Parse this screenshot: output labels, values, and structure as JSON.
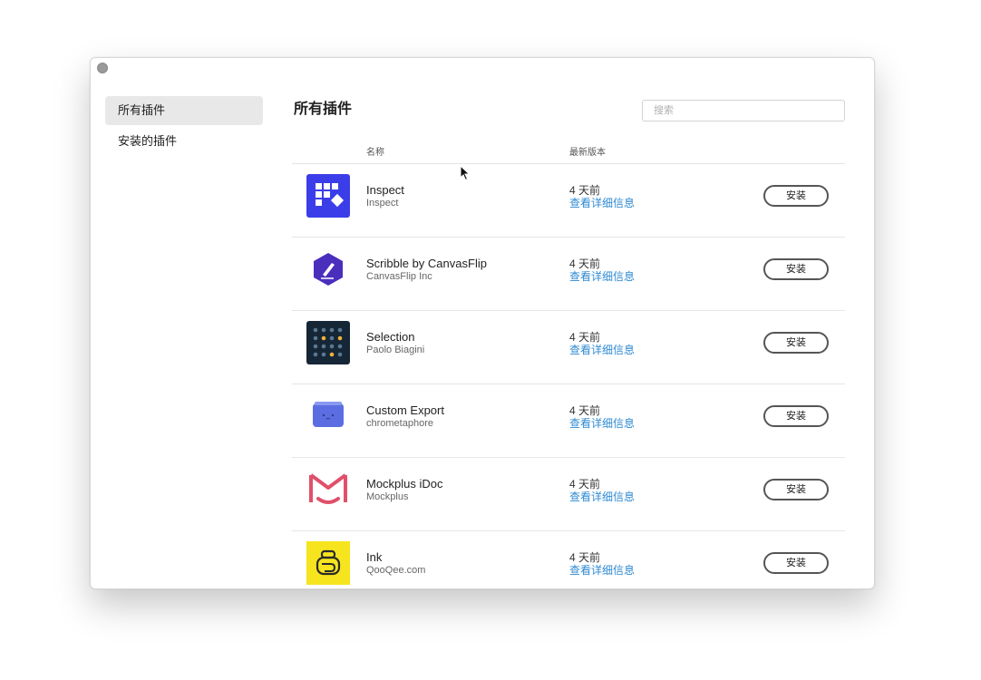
{
  "sidebar": {
    "items": [
      {
        "label": "所有插件"
      },
      {
        "label": "安装的插件"
      }
    ]
  },
  "main": {
    "title": "所有插件",
    "search_placeholder": "搜索",
    "columns": {
      "name": "名称",
      "version": "最新版本"
    }
  },
  "plugins": [
    {
      "name": "Inspect",
      "author": "Inspect",
      "date": "4 天前",
      "link": "查看详细信息",
      "button": "安装",
      "icon": "inspect-icon"
    },
    {
      "name": "Scribble by CanvasFlip",
      "author": "CanvasFlip Inc",
      "date": "4 天前",
      "link": "查看详细信息",
      "button": "安装",
      "icon": "scribble-icon"
    },
    {
      "name": "Selection",
      "author": "Paolo Biagini",
      "date": "4 天前",
      "link": "查看详细信息",
      "button": "安装",
      "icon": "selection-icon"
    },
    {
      "name": "Custom Export",
      "author": "chrometaphore",
      "date": "4 天前",
      "link": "查看详细信息",
      "button": "安装",
      "icon": "custom-export-icon"
    },
    {
      "name": "Mockplus iDoc",
      "author": "Mockplus",
      "date": "4 天前",
      "link": "查看详细信息",
      "button": "安装",
      "icon": "mockplus-icon"
    },
    {
      "name": "Ink",
      "author": "QooQee.com",
      "date": "4 天前",
      "link": "查看详细信息",
      "button": "安装",
      "icon": "ink-icon"
    }
  ],
  "colors": {
    "link": "#2f8ad2",
    "sidebar_active_bg": "#e8e8e8",
    "inspect_icon_bg": "#3b3ee8",
    "scribble_icon_bg": "#4a2fbd",
    "selection_icon_bg": "#152636",
    "custom_export_icon_bg": "#5b6ee1",
    "mockplus_icon_color": "#e0506a",
    "ink_icon_bg": "#f6e41e"
  }
}
